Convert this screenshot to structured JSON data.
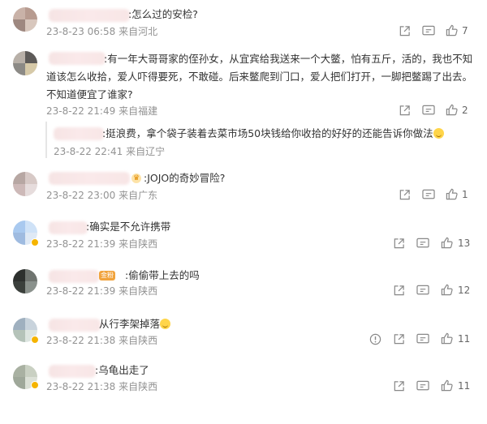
{
  "comments": [
    {
      "text": ":怎么过的安检?",
      "time": "23-8-23 06:58",
      "location": "来自河北",
      "likes": "7"
    },
    {
      "text_line1": ":有一年大哥哥家的侄孙女，从宜宾给我送来一个大鳖，怕有五斤，活的，我也不知",
      "text_line2": "道该怎么收拾，爱人吓得要死，不敢碰。后来鳖爬到门口，爱人把们打开，一脚把鳖踢了出去。",
      "text_line3": "不知道便宜了谁家?",
      "time": "23-8-22 21:49",
      "location": "来自福建",
      "likes": "2"
    },
    {
      "text": ":JOJO的奇妙冒险?",
      "time": "23-8-22 23:00",
      "location": "来自广东",
      "likes": "1"
    },
    {
      "text": ":确实是不允许携带",
      "time": "23-8-22 21:39",
      "location": "来自陕西",
      "likes": "13"
    },
    {
      "text": ":偷偷带上去的吗",
      "badge": "金粉",
      "time": "23-8-22 21:39",
      "location": "来自陕西",
      "likes": "12"
    },
    {
      "text": "从行李架掉落",
      "time": "23-8-22 21:38",
      "location": "来自陕西",
      "likes": "11"
    },
    {
      "text": ":乌龟出走了",
      "time": "23-8-22 21:38",
      "location": "来自陕西",
      "likes": "11"
    }
  ],
  "reply": {
    "text": ":挺浪费，拿个袋子装着去菜市场50块钱给你收拾的好好的还能告诉你做法",
    "time": "23-8-22 22:41",
    "location": "来自辽宁"
  },
  "icons": {
    "share": "share-icon",
    "comment": "comment-icon",
    "like": "like-icon",
    "report": "report-icon"
  }
}
